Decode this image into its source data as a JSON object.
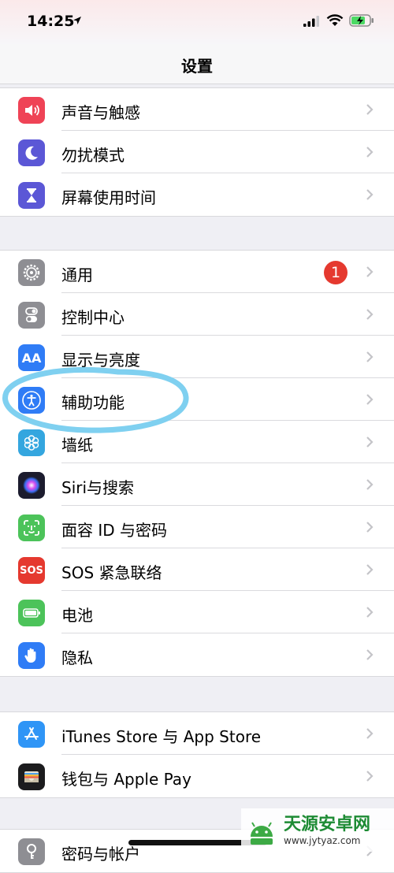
{
  "status": {
    "time": "14:25"
  },
  "nav": {
    "title": "设置"
  },
  "groups": [
    {
      "items": [
        {
          "label": "声音与触感",
          "icon": "speaker-icon",
          "color": "#ef4356"
        },
        {
          "label": "勿扰模式",
          "icon": "moon-icon",
          "color": "#5b57d6"
        },
        {
          "label": "屏幕使用时间",
          "icon": "hourglass-icon",
          "color": "#5b57d6"
        }
      ]
    },
    {
      "items": [
        {
          "label": "通用",
          "icon": "gear-icon",
          "color": "#8e8e93",
          "badge": "1"
        },
        {
          "label": "控制中心",
          "icon": "toggles-icon",
          "color": "#8e8e93"
        },
        {
          "label": "显示与亮度",
          "icon": "text-size-icon",
          "color": "#2f7cf6",
          "icon_text": "AA"
        },
        {
          "label": "辅助功能",
          "icon": "accessibility-icon",
          "color": "#2f7cf6"
        },
        {
          "label": "墙纸",
          "icon": "flower-icon",
          "color": "#34a6df"
        },
        {
          "label": "Siri与搜索",
          "icon": "siri-icon",
          "color": "#1c1c2e"
        },
        {
          "label": "面容 ID 与密码",
          "icon": "face-id-icon",
          "color": "#4cc35a"
        },
        {
          "label": "SOS 紧急联络",
          "icon": "sos-icon",
          "color": "#e5392f",
          "icon_text": "SOS"
        },
        {
          "label": "电池",
          "icon": "battery-icon",
          "color": "#4cc35a"
        },
        {
          "label": "隐私",
          "icon": "hand-icon",
          "color": "#2f7cf6"
        }
      ]
    },
    {
      "items": [
        {
          "label": "iTunes Store 与 App Store",
          "icon": "app-store-icon",
          "color": "#2f95f6"
        },
        {
          "label": "钱包与 Apple Pay",
          "icon": "wallet-icon",
          "color": "#1c1c1e"
        }
      ]
    },
    {
      "items": [
        {
          "label": "密码与帐户",
          "icon": "key-icon",
          "color": "#8e8e93"
        }
      ]
    }
  ],
  "colors": {
    "background": "#efeff4",
    "annotation": "#7fd0f0",
    "badge": "#e5392f"
  },
  "watermark": {
    "title": "天源安卓网",
    "url": "www.jytyaz.com"
  }
}
